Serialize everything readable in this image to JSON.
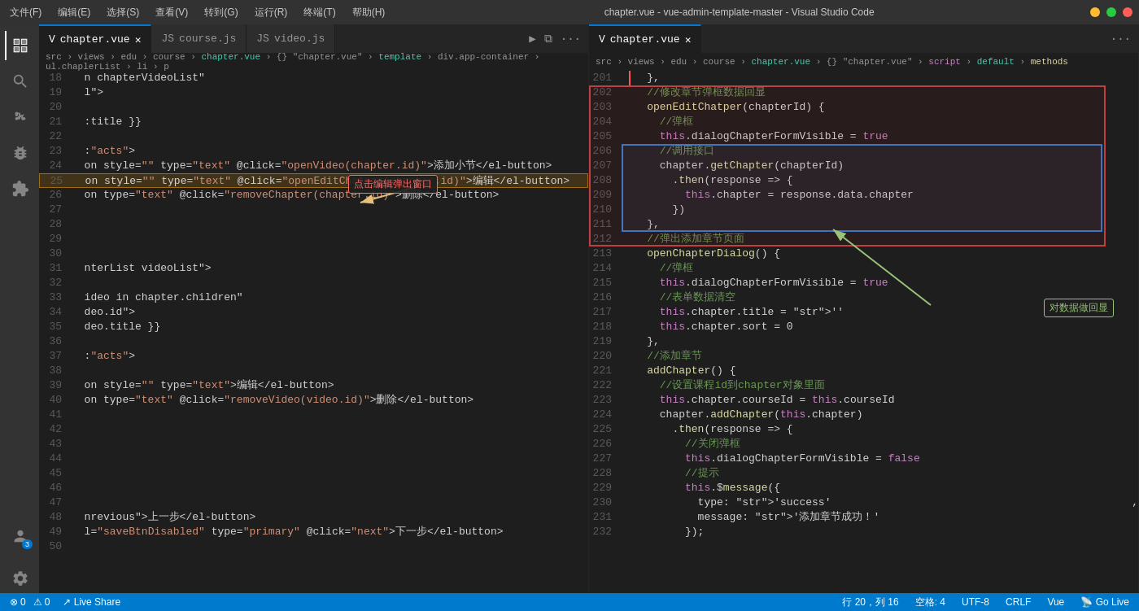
{
  "titlebar": {
    "title": "chapter.vue - vue-admin-template-master - Visual Studio Code",
    "menu": [
      "文件(F)",
      "编辑(E)",
      "选择(S)",
      "查看(V)",
      "转到(G)",
      "运行(R)",
      "终端(T)",
      "帮助(H)"
    ]
  },
  "left_pane": {
    "tabs": [
      {
        "id": "chapter-vue",
        "label": "chapter.vue",
        "type": "vue",
        "active": true
      },
      {
        "id": "course-js",
        "label": "course.js",
        "type": "js",
        "active": false
      },
      {
        "id": "video-js",
        "label": "video.js",
        "type": "js",
        "active": false
      }
    ],
    "breadcrumb": "src › views › edu › course › chapter.vue › {} \"chapter.vue\" › template › div.app-container › ul.chaplerList › li › p",
    "lines": [
      {
        "num": 18,
        "content": "  n chapterVideoList\""
      },
      {
        "num": 19,
        "content": "  l\">"
      },
      {
        "num": 20,
        "content": ""
      },
      {
        "num": 21,
        "content": "  :title }}"
      },
      {
        "num": 22,
        "content": ""
      },
      {
        "num": 23,
        "content": "  :\"acts\">"
      },
      {
        "num": 24,
        "content": "  on style=\"\" type=\"text\" @click=\"openVideo(chapter.id)\">添加小节</el-button>"
      },
      {
        "num": 25,
        "content": "  on style=\"\" type=\"text\" @click=\"openEditChatper(chapter.id)\">编辑</el-button>",
        "highlight": "orange"
      },
      {
        "num": 26,
        "content": "  on type=\"text\" @click=\"removeChapter(chapter.id)\">删除</el-button>"
      },
      {
        "num": 27,
        "content": ""
      },
      {
        "num": 28,
        "content": ""
      },
      {
        "num": 29,
        "content": ""
      },
      {
        "num": 30,
        "content": ""
      },
      {
        "num": 31,
        "content": "  nterList videoList\">"
      },
      {
        "num": 32,
        "content": ""
      },
      {
        "num": 33,
        "content": "  ideo in chapter.children\""
      },
      {
        "num": 34,
        "content": "  deo.id\">"
      },
      {
        "num": 35,
        "content": "  deo.title }}"
      },
      {
        "num": 36,
        "content": ""
      },
      {
        "num": 37,
        "content": "  :\"acts\">"
      },
      {
        "num": 38,
        "content": ""
      },
      {
        "num": 39,
        "content": "  on style=\"\" type=\"text\">编辑</el-button>"
      },
      {
        "num": 40,
        "content": "  on type=\"text\" @click=\"removeVideo(video.id)\">删除</el-button>"
      },
      {
        "num": 41,
        "content": ""
      },
      {
        "num": 42,
        "content": ""
      },
      {
        "num": 43,
        "content": ""
      },
      {
        "num": 44,
        "content": ""
      },
      {
        "num": 45,
        "content": ""
      },
      {
        "num": 46,
        "content": ""
      },
      {
        "num": 47,
        "content": ""
      },
      {
        "num": 48,
        "content": "  nrevious\">上一步</el-button>"
      },
      {
        "num": 49,
        "content": "  l=\"saveBtnDisabled\" type=\"primary\" @click=\"next\">下一步</el-button>"
      },
      {
        "num": 50,
        "content": ""
      }
    ]
  },
  "right_pane": {
    "tabs": [
      {
        "id": "chapter-vue-r",
        "label": "chapter.vue",
        "type": "vue",
        "active": true
      }
    ],
    "breadcrumb": "src › views › edu › course › chapter.vue › {} \"chapter.vue\" › script › default › methods",
    "lines": [
      {
        "num": 201,
        "content": "    },"
      },
      {
        "num": 202,
        "content": "    //修改章节弹框数据回显",
        "highlight": "red_comment"
      },
      {
        "num": 203,
        "content": "    openEditChatper(chapterId) {",
        "highlight": "red_start"
      },
      {
        "num": 204,
        "content": "      //弹框"
      },
      {
        "num": 205,
        "content": "      this.dialogChapterFormVisible = true"
      },
      {
        "num": 206,
        "content": "      //调用接口",
        "highlight": "blue_start"
      },
      {
        "num": 207,
        "content": "      chapter.getChapter(chapterId)"
      },
      {
        "num": 208,
        "content": "        .then(response => {"
      },
      {
        "num": 209,
        "content": "          this.chapter = response.data.chapter"
      },
      {
        "num": 210,
        "content": "        })"
      },
      {
        "num": 211,
        "content": "    },",
        "highlight": "blue_end"
      },
      {
        "num": 212,
        "content": "    //弹出添加章节页面"
      },
      {
        "num": 213,
        "content": "    openChapterDialog() {"
      },
      {
        "num": 214,
        "content": "      //弹框"
      },
      {
        "num": 215,
        "content": "      this.dialogChapterFormVisible = true"
      },
      {
        "num": 216,
        "content": "      //表单数据清空"
      },
      {
        "num": 217,
        "content": "      this.chapter.title = ''"
      },
      {
        "num": 218,
        "content": "      this.chapter.sort = 0"
      },
      {
        "num": 219,
        "content": "    },"
      },
      {
        "num": 220,
        "content": "    //添加章节"
      },
      {
        "num": 221,
        "content": "    addChapter() {"
      },
      {
        "num": 222,
        "content": "      //设置课程id到chapter对象里面"
      },
      {
        "num": 223,
        "content": "      this.chapter.courseId = this.courseId"
      },
      {
        "num": 224,
        "content": "      chapter.addChapter(this.chapter)"
      },
      {
        "num": 225,
        "content": "        .then(response => {"
      },
      {
        "num": 226,
        "content": "          //关闭弹框"
      },
      {
        "num": 227,
        "content": "          this.dialogChapterFormVisible = false"
      },
      {
        "num": 228,
        "content": "          //提示"
      },
      {
        "num": 229,
        "content": "          this.$message({"
      },
      {
        "num": 230,
        "content": "            type: 'success',"
      },
      {
        "num": 231,
        "content": "            message: '添加章节成功！'"
      },
      {
        "num": 232,
        "content": "          });"
      }
    ]
  },
  "statusbar": {
    "errors": "0",
    "warnings": "0",
    "live_share": "Live Share",
    "line_col": "行 20，列 16",
    "spaces": "空格: 4",
    "encoding": "UTF-8",
    "line_ending": "CRLF",
    "language": "Vue",
    "go_live": "Go Live"
  },
  "annotations": {
    "left": "点击编辑弹出窗口",
    "right": "对数据做回显"
  }
}
